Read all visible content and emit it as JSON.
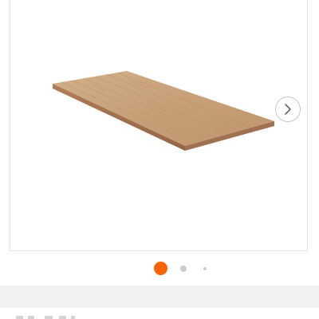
{
  "product_gallery": {
    "image_subject": "butcher-block-countertop",
    "next_icon": "chevron-right-icon",
    "dots": [
      {
        "state": "active"
      },
      {
        "state": "inactive"
      },
      {
        "state": "inactive"
      }
    ]
  },
  "colors": {
    "accent": "#f96302",
    "dot_inactive": "#cccccc",
    "chevron": "#666666",
    "wood_top": "#c9a37b",
    "wood_edge": "#a57650",
    "band": "#f2f2f2"
  }
}
